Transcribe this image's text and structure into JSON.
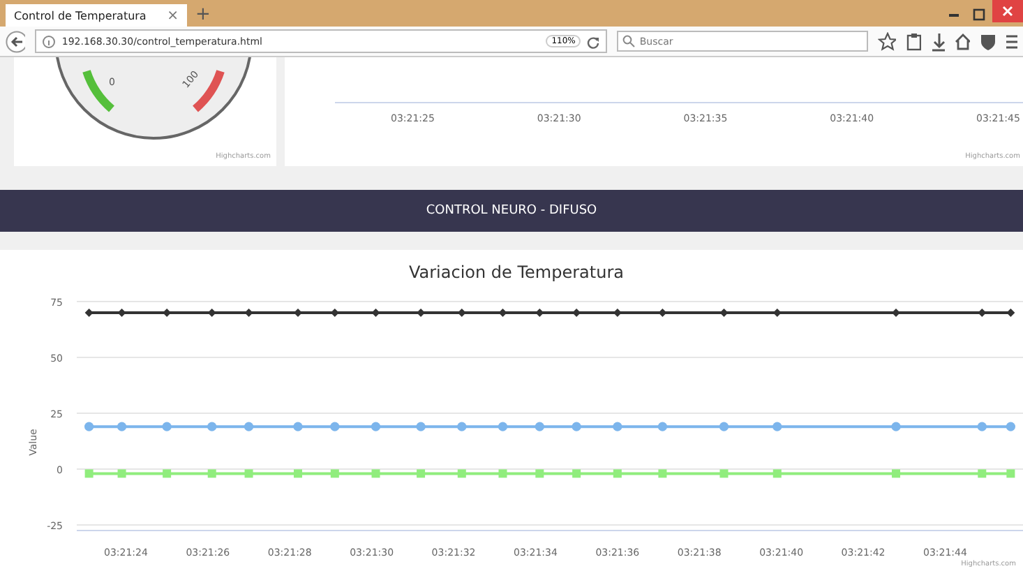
{
  "browser": {
    "tab": {
      "title": "Control de Temperatura",
      "selected": true,
      "close": "×"
    },
    "new_tab": "+",
    "url": "192.168.30.30/control_temperatura.html",
    "zoom": "110%",
    "search": {
      "placeholder": "Buscar"
    }
  },
  "gauge": {
    "labels": [
      "0",
      "100"
    ],
    "credit": "Highcharts.com"
  },
  "upper_chart": {
    "x_labels": [
      "03:21:25",
      "03:21:30",
      "03:21:35",
      "03:21:40",
      "03:21:45"
    ],
    "credit": "Highcharts.com"
  },
  "banner": "CONTROL NEURO - DIFUSO",
  "chart": {
    "credit": "Highcharts.com",
    "chart_data": {
      "type": "line",
      "title": "Variacion de Temperatura",
      "ylabel": "Value",
      "grid": true,
      "xlim": [
        12082.8,
        12105.9
      ],
      "x": [
        12083.1,
        12083.9,
        12085.0,
        12086.1,
        12087.0,
        12088.2,
        12089.1,
        12090.1,
        12091.2,
        12092.2,
        12093.2,
        12094.1,
        12095.0,
        12096.0,
        12097.1,
        12098.6,
        12099.9,
        12102.8,
        12104.9,
        12105.6
      ],
      "series": [
        {
          "color": "#333333",
          "marker": "diamond",
          "values": [
            70,
            70,
            70,
            70,
            70,
            70,
            70,
            70,
            70,
            70,
            70,
            70,
            70,
            70,
            70,
            70,
            70,
            70,
            70,
            70
          ]
        },
        {
          "color": "#7cb5ec",
          "marker": "circle",
          "values": [
            19,
            19,
            19,
            19,
            19,
            19,
            19,
            19,
            19,
            19,
            19,
            19,
            19,
            19,
            19,
            19,
            19,
            19,
            19,
            19
          ]
        },
        {
          "color": "#90ed7d",
          "marker": "square",
          "values": [
            -2,
            -2,
            -2,
            -2,
            -2,
            -2,
            -2,
            -2,
            -2,
            -2,
            -2,
            -2,
            -2,
            -2,
            -2,
            -2,
            -2,
            -2,
            -2,
            -2
          ]
        }
      ],
      "ylim": [
        -25,
        75
      ],
      "yticks": [
        -25,
        0,
        25,
        50,
        75
      ],
      "xticks": [
        {
          "value": 12084,
          "label": "03:21:24"
        },
        {
          "value": 12086,
          "label": "03:21:26"
        },
        {
          "value": 12088,
          "label": "03:21:28"
        },
        {
          "value": 12090,
          "label": "03:21:30"
        },
        {
          "value": 12092,
          "label": "03:21:32"
        },
        {
          "value": 12094,
          "label": "03:21:34"
        },
        {
          "value": 12096,
          "label": "03:21:36"
        },
        {
          "value": 12098,
          "label": "03:21:38"
        },
        {
          "value": 12100,
          "label": "03:21:40"
        },
        {
          "value": 12102,
          "label": "03:21:42"
        },
        {
          "value": 12104,
          "label": "03:21:44"
        }
      ]
    }
  }
}
